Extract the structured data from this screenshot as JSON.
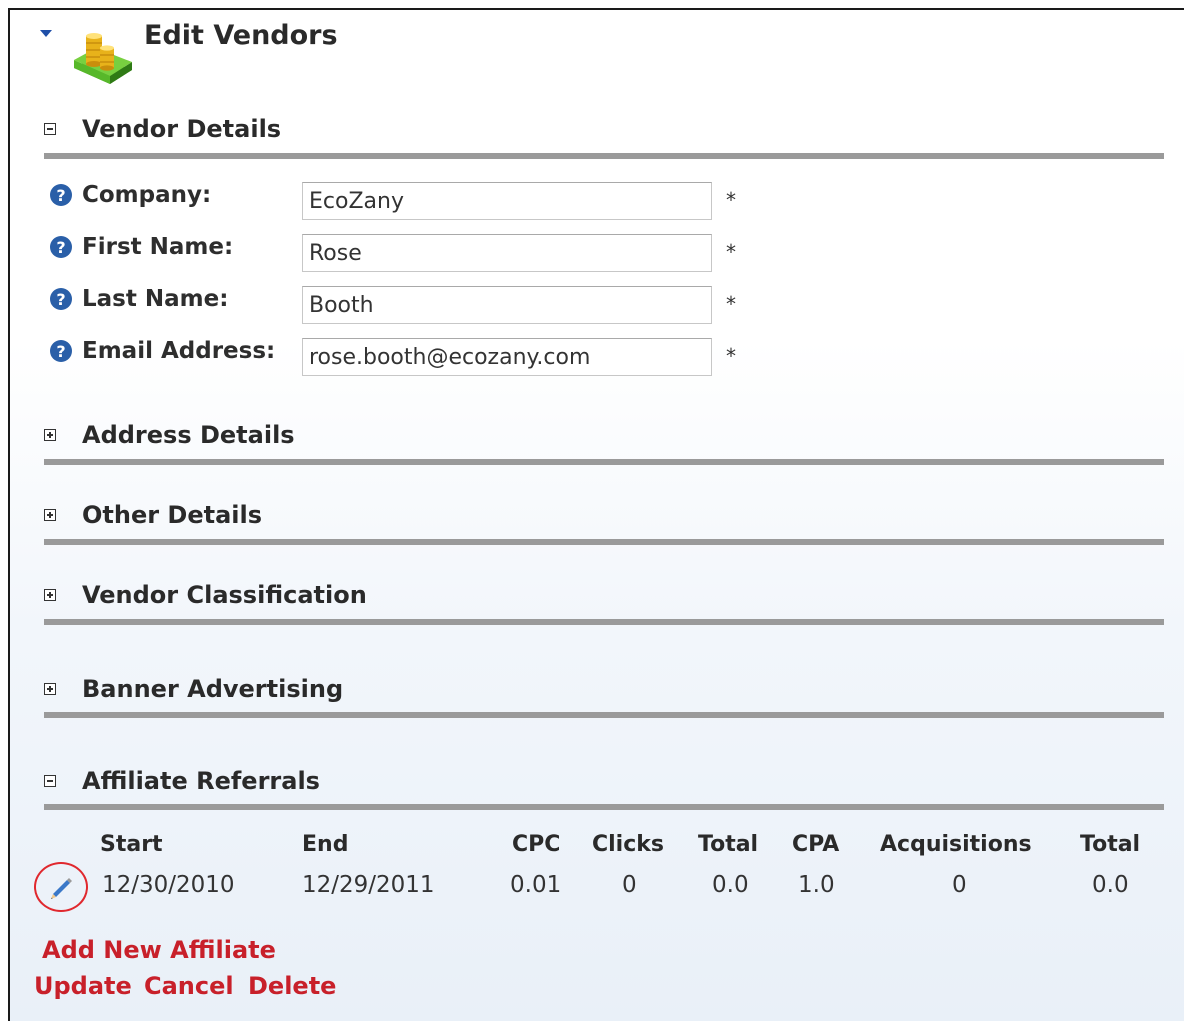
{
  "header": {
    "title": "Edit Vendors"
  },
  "sections": {
    "vendor_details": "Vendor Details",
    "address_details": "Address Details",
    "other_details": "Other Details",
    "vendor_classification": "Vendor Classification",
    "banner_advertising": "Banner Advertising",
    "affiliate_referrals": "Affiliate Referrals"
  },
  "vendor": {
    "company_label": "Company:",
    "company_value": "EcoZany",
    "first_name_label": "First Name:",
    "first_name_value": "Rose",
    "last_name_label": "Last Name:",
    "last_name_value": "Booth",
    "email_label": "Email Address:",
    "email_value": "rose.booth@ecozany.com",
    "required_marker": "*"
  },
  "affiliates": {
    "columns": [
      "Start",
      "End",
      "CPC",
      "Clicks",
      "Total",
      "CPA",
      "Acquisitions",
      "Total"
    ],
    "rows": [
      [
        "12/30/2010",
        "12/29/2011",
        "0.01",
        "0",
        "0.0",
        "1.0",
        "0",
        "0.0"
      ]
    ],
    "add_link": "Add New Affiliate"
  },
  "actions": {
    "update": "Update",
    "cancel": "Cancel",
    "delete": "Delete"
  },
  "icons": {
    "collapse": "triangle-down-icon",
    "title": "coins-stack-icon",
    "help": "help-circle-icon",
    "edit": "pencil-icon",
    "expand": "plus-box-icon",
    "collapse_section": "minus-box-icon"
  },
  "colors": {
    "link": "#c8202a",
    "help": "#2a5fa8",
    "rule": "#9a9a9a",
    "highlight": "#e0282e"
  }
}
